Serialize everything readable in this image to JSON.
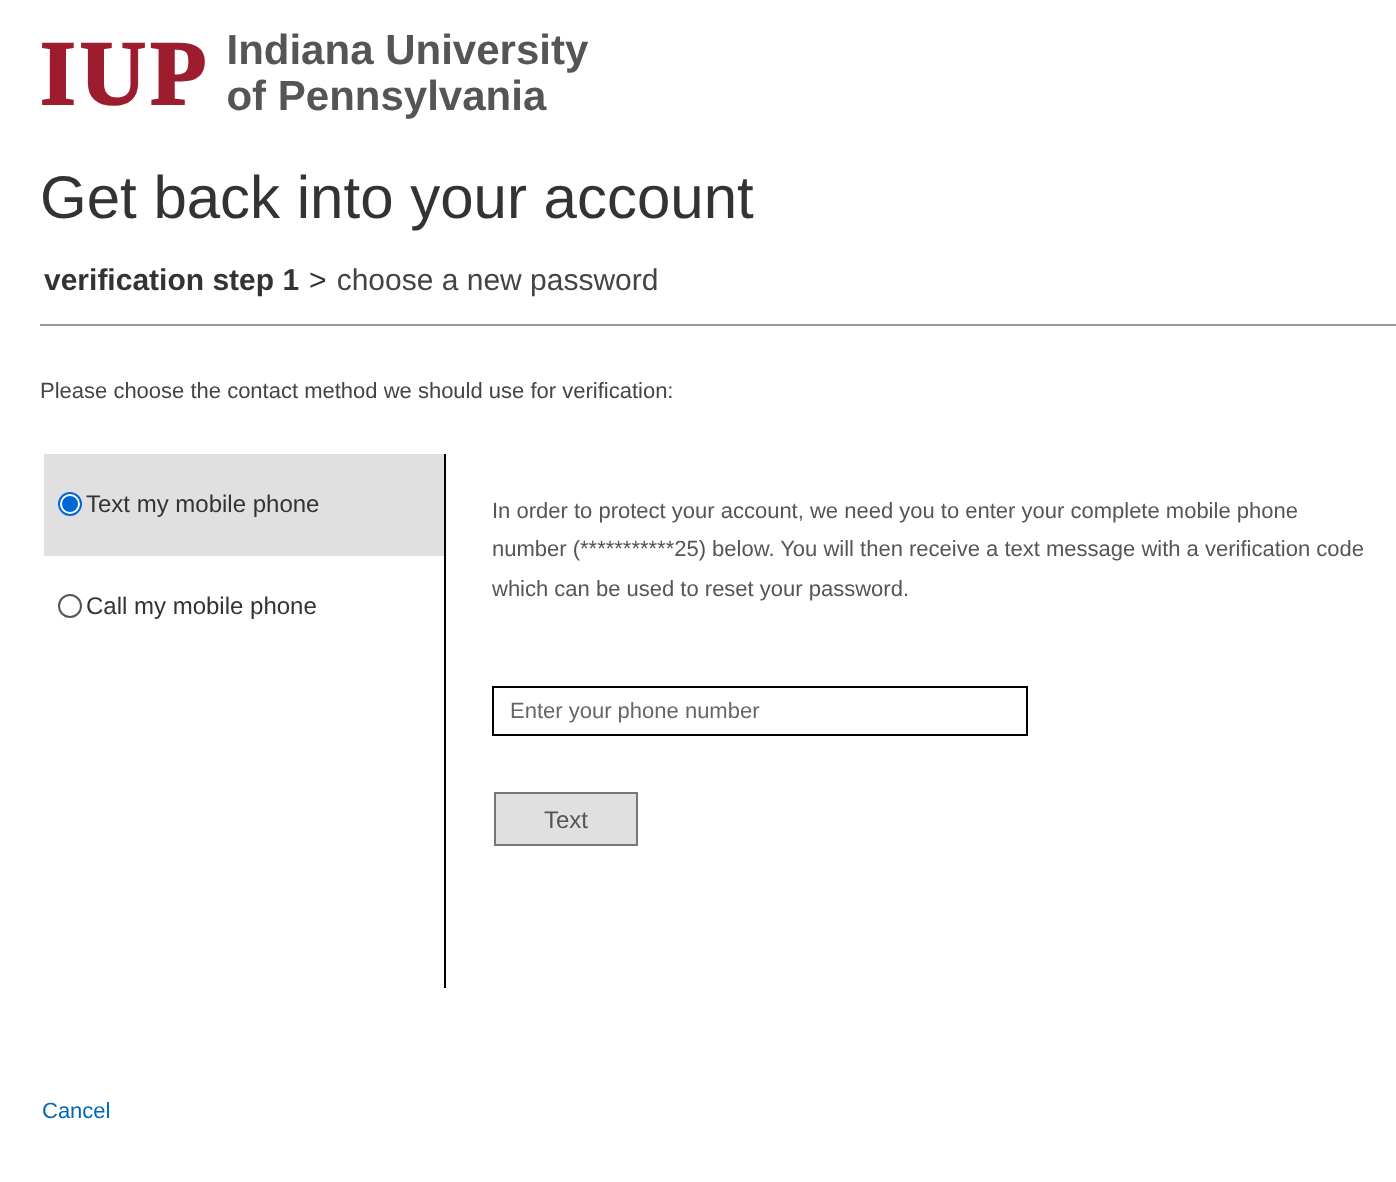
{
  "logo": {
    "mark": "IUP",
    "name_line_1": "Indiana University",
    "name_line_2": "of Pennsylvania"
  },
  "title": "Get back into your account",
  "steps": {
    "current": "verification step 1",
    "separator": ">",
    "next": "choose a new password"
  },
  "instruction": "Please choose the contact method we should use for verification:",
  "methods": [
    {
      "label": "Text my mobile phone",
      "selected": true
    },
    {
      "label": "Call my mobile phone",
      "selected": false
    }
  ],
  "detail": {
    "text": "In order to protect your account, we need you to enter your complete mobile phone number (***********25) below. You will then receive a text message with a verification code which can be used to reset your password.",
    "placeholder": "Enter your phone number",
    "button": "Text"
  },
  "cancel": "Cancel"
}
